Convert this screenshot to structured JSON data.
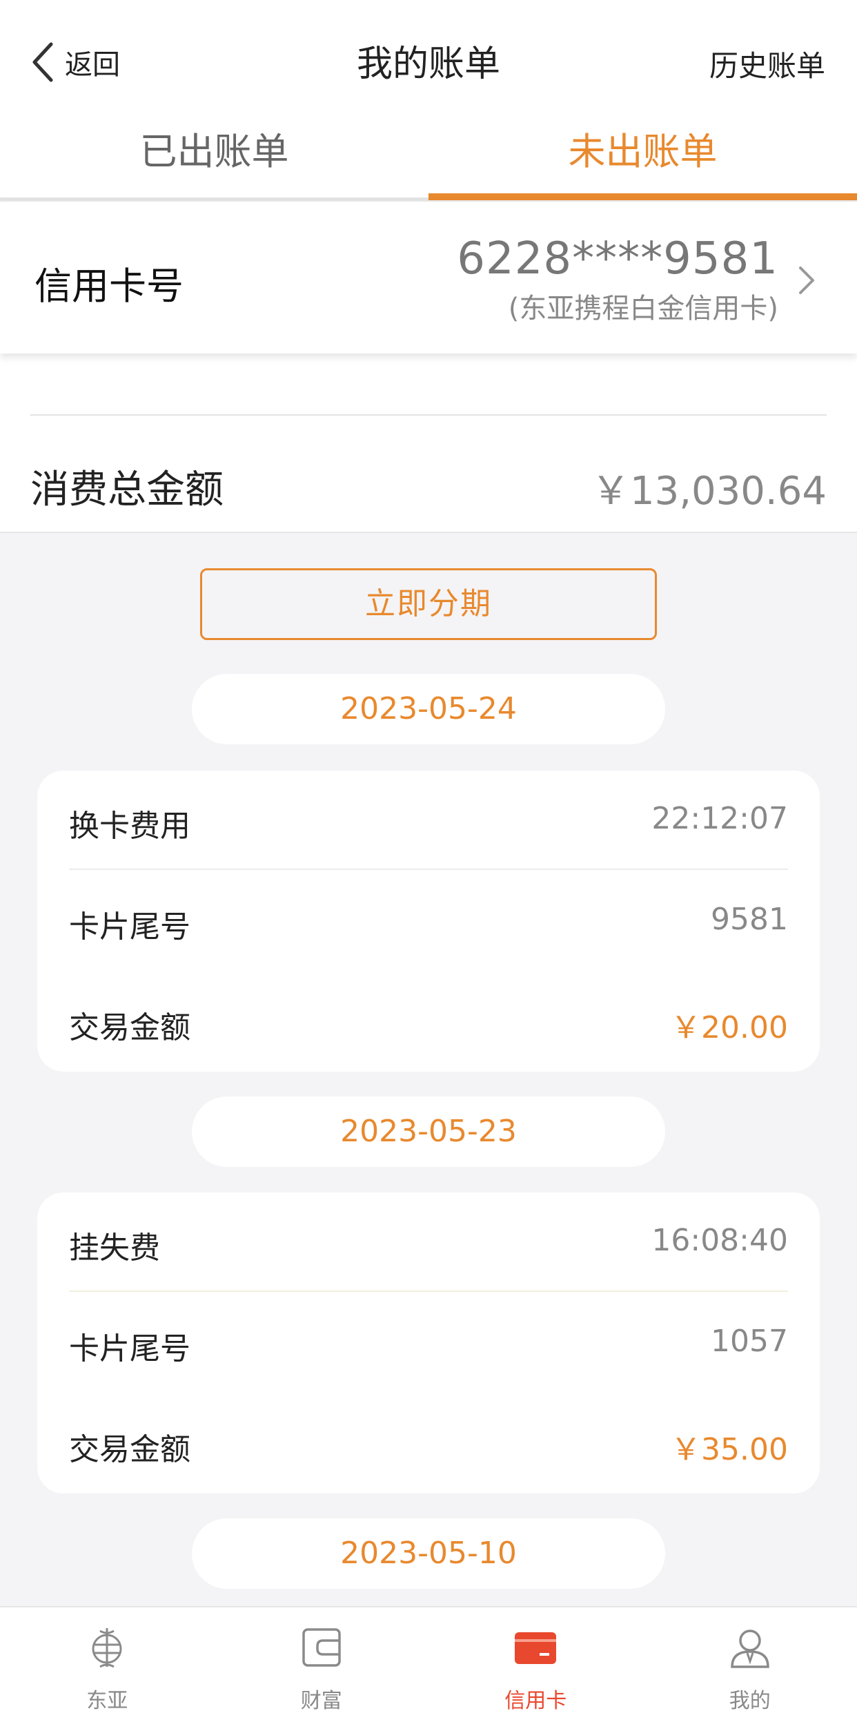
{
  "nav": {
    "back_label": "返回",
    "title": "我的账单",
    "history_label": "历史账单"
  },
  "tabs": [
    {
      "label": "已出账单",
      "active": false
    },
    {
      "label": "未出账单",
      "active": true
    }
  ],
  "card": {
    "label": "信用卡号",
    "number": "6228****9581",
    "name": "(东亚携程白金信用卡)"
  },
  "total": {
    "label": "消费总金额",
    "value": "￥13,030.64"
  },
  "install_button": "立即分期",
  "groups": [
    {
      "date": "2023-05-24",
      "tx": {
        "type": "换卡费用",
        "time": "22:12:07",
        "card_tail_label": "卡片尾号",
        "card_tail": "9581",
        "amount_label": "交易金额",
        "amount": "￥20.00"
      }
    },
    {
      "date": "2023-05-23",
      "tx": {
        "type": "挂失费",
        "time": "16:08:40",
        "card_tail_label": "卡片尾号",
        "card_tail": "1057",
        "amount_label": "交易金额",
        "amount": "￥35.00"
      }
    },
    {
      "date": "2023-05-10"
    }
  ],
  "bottom_tabs": [
    {
      "label": "东亚",
      "icon": "bea-logo-icon",
      "active": false
    },
    {
      "label": "财富",
      "icon": "wallet-icon",
      "active": false
    },
    {
      "label": "信用卡",
      "icon": "credit-card-icon",
      "active": true
    },
    {
      "label": "我的",
      "icon": "user-icon",
      "active": false
    }
  ],
  "colors": {
    "accent": "#e8892e",
    "active_tab_red": "#e8482d",
    "background": "#f4f4f6"
  }
}
